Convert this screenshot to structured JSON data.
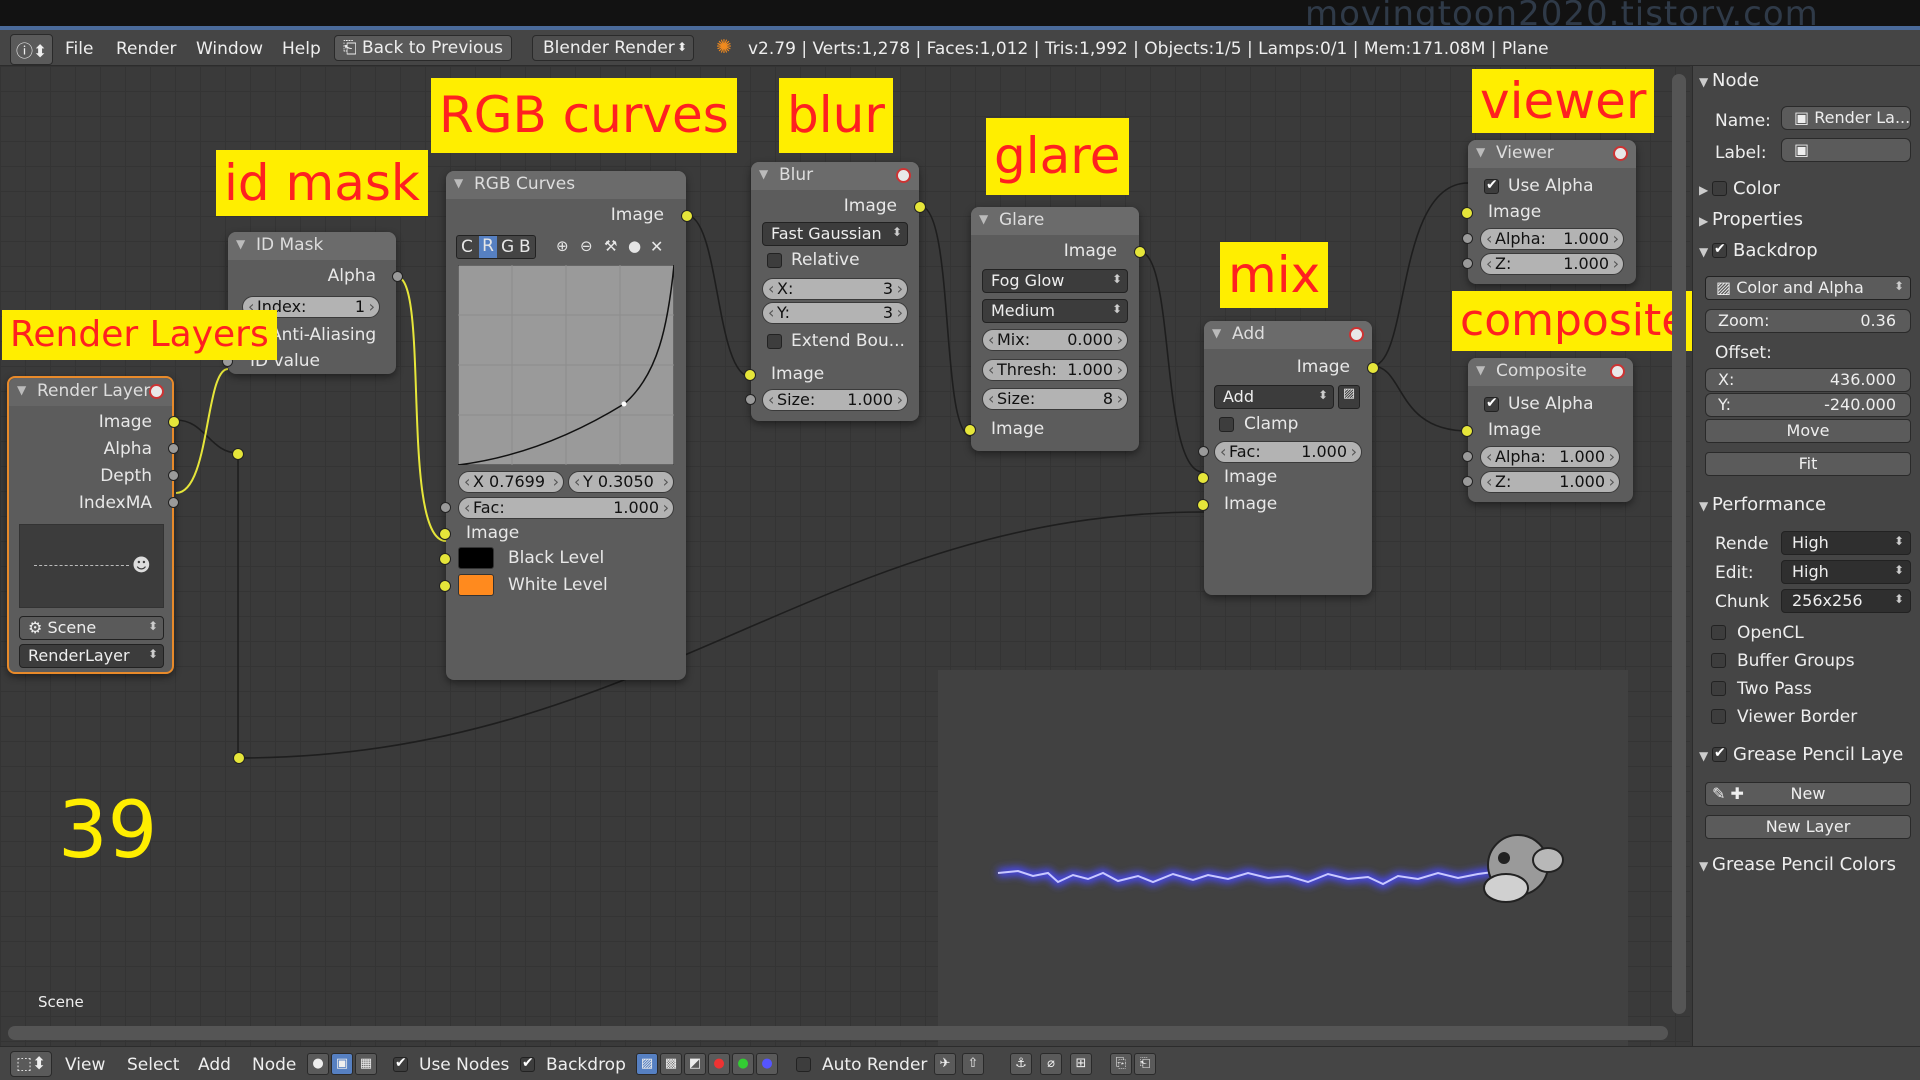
{
  "watermark": "movingtoon2020.tistory.com",
  "menubar": {
    "items": [
      "File",
      "Render",
      "Window",
      "Help"
    ],
    "back_button": "Back to Previous",
    "engine": "Blender Render",
    "stats": "v2.79 | Verts:1,278 | Faces:1,012 | Tris:1,992 | Objects:1/5 | Lamps:0/1 | Mem:171.08M | Plane"
  },
  "labels": {
    "render_layers": "Render Layers",
    "id_mask": "id mask",
    "rgb_curves": "RGB curves",
    "blur": "blur",
    "glare": "glare",
    "mix": "mix",
    "viewer": "viewer",
    "composite": "composite",
    "frame_number": "39"
  },
  "nodes": {
    "render_layers": {
      "title": "Render Layers",
      "outputs": [
        "Image",
        "Alpha",
        "Depth",
        "IndexMA"
      ],
      "scene": "Scene",
      "layer": "RenderLayer"
    },
    "id_mask": {
      "title": "ID Mask",
      "output": "Alpha",
      "index_label": "Index:",
      "index_value": "1",
      "anti_aliasing": "Anti-Aliasing",
      "input": "ID value"
    },
    "rgb_curves": {
      "title": "RGB Curves",
      "output": "Image",
      "channels": [
        "C",
        "R",
        "G",
        "B"
      ],
      "x_readout": "X 0.7699",
      "y_readout": "Y 0.3050",
      "fac_label": "Fac:",
      "fac_value": "1.000",
      "inputs": [
        "Image",
        "Black Level",
        "White Level"
      ],
      "black_color": "#000000",
      "white_color": "#ff8a1e"
    },
    "blur": {
      "title": "Blur",
      "output": "Image",
      "filter": "Fast Gaussian",
      "relative": "Relative",
      "x_label": "X:",
      "x_value": "3",
      "y_label": "Y:",
      "y_value": "3",
      "extend": "Extend Bou...",
      "input": "Image",
      "size_label": "Size:",
      "size_value": "1.000"
    },
    "glare": {
      "title": "Glare",
      "output": "Image",
      "type": "Fog Glow",
      "quality": "Medium",
      "mix_label": "Mix:",
      "mix_value": "0.000",
      "thresh_label": "Thresh:",
      "thresh_value": "1.000",
      "size_label": "Size:",
      "size_value": "8",
      "input": "Image"
    },
    "mix": {
      "title": "Add",
      "output": "Image",
      "blend": "Add",
      "clamp": "Clamp",
      "fac_label": "Fac:",
      "fac_value": "1.000",
      "inputs": [
        "Image",
        "Image"
      ]
    },
    "viewer": {
      "title": "Viewer",
      "use_alpha": "Use Alpha",
      "input": "Image",
      "alpha_label": "Alpha:",
      "alpha_value": "1.000",
      "z_label": "Z:",
      "z_value": "1.000"
    },
    "composite": {
      "title": "Composite",
      "use_alpha": "Use Alpha",
      "input": "Image",
      "alpha_label": "Alpha:",
      "alpha_value": "1.000",
      "z_label": "Z:",
      "z_value": "1.000"
    }
  },
  "editor": {
    "scene_label": "Scene"
  },
  "right_panel": {
    "node_header": "Node",
    "name_label": "Name:",
    "name_value": "Render La...",
    "label_label": "Label:",
    "color": "Color",
    "properties": "Properties",
    "backdrop": "Backdrop",
    "backdrop_mode": "Color and Alpha",
    "zoom_label": "Zoom:",
    "zoom_value": "0.36",
    "offset_label": "Offset:",
    "offset_x_label": "X:",
    "offset_x_value": "436.000",
    "offset_y_label": "Y:",
    "offset_y_value": "-240.000",
    "move": "Move",
    "fit": "Fit",
    "performance": "Performance",
    "render_label": "Rende",
    "render_value": "High",
    "edit_label": "Edit:",
    "edit_value": "High",
    "chunk_label": "Chunk",
    "chunk_value": "256x256",
    "opencl": "OpenCL",
    "buffer_groups": "Buffer Groups",
    "two_pass": "Two Pass",
    "viewer_border": "Viewer Border",
    "grease_layers": "Grease Pencil Laye",
    "new": "New",
    "new_layer": "New Layer",
    "grease_colors": "Grease Pencil Colors"
  },
  "bottombar": {
    "items": [
      "View",
      "Select",
      "Add",
      "Node"
    ],
    "use_nodes": "Use Nodes",
    "backdrop": "Backdrop",
    "auto_render": "Auto Render"
  }
}
